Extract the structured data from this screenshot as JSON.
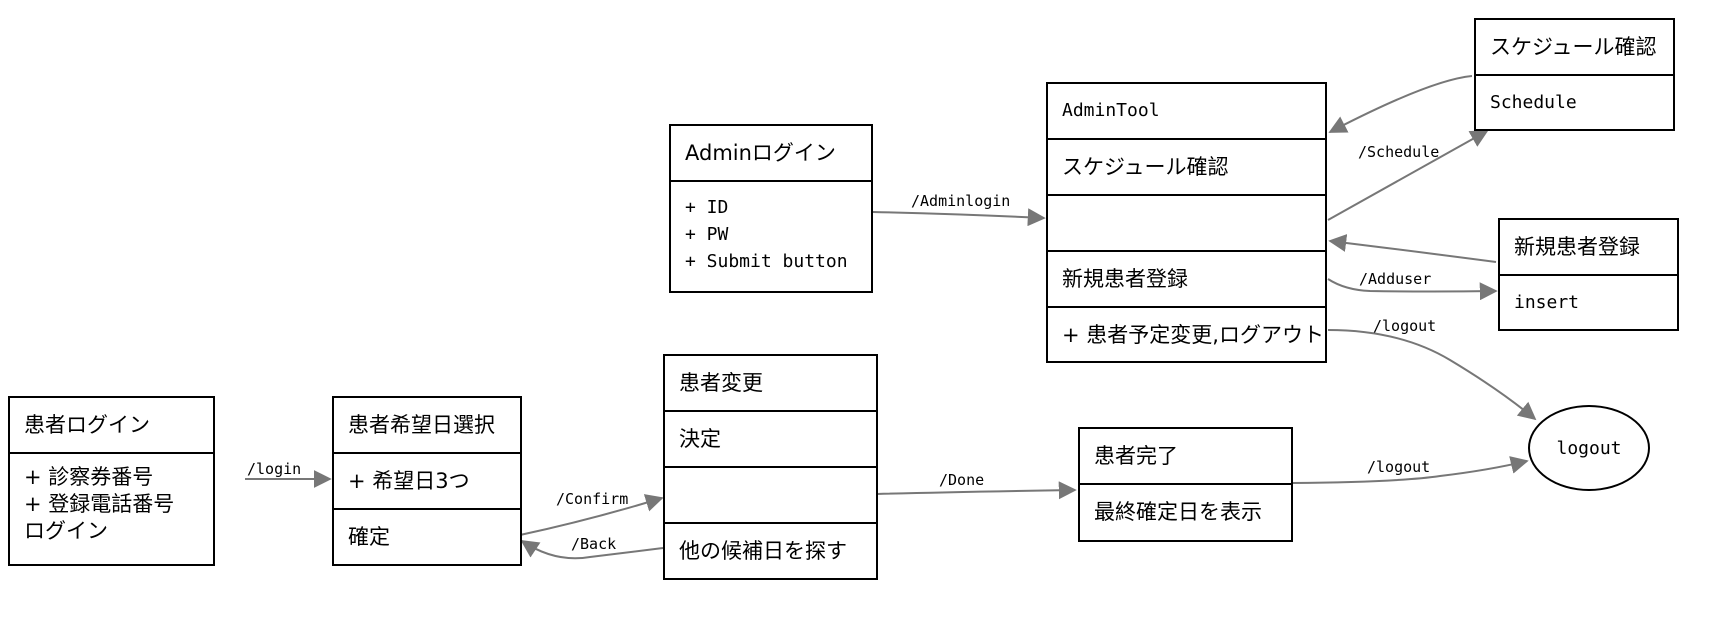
{
  "colors": {
    "edge": "#777777",
    "stroke": "#000000"
  },
  "nodes": {
    "patient_login": {
      "title": "患者ログイン",
      "lines": [
        "+ 診察券番号",
        "+ 登録電話番号",
        "ログイン"
      ]
    },
    "patient_select": {
      "title": "患者希望日選択",
      "field": "+ 希望日3つ",
      "confirm": "確定"
    },
    "patient_change": {
      "title": "患者変更",
      "decide": "決定",
      "empty": "",
      "search": "他の候補日を探す"
    },
    "patient_done": {
      "title": "患者完了",
      "show": "最終確定日を表示"
    },
    "admin_login": {
      "title": "Adminログイン",
      "lines": [
        "+ ID",
        "+ PW",
        "+ Submit button"
      ]
    },
    "admin_tool": {
      "title": "AdminTool",
      "schedule": "スケジュール確認",
      "empty": "",
      "register": "新規患者登録",
      "bottom": "+ 患者予定変更,ログアウト"
    },
    "schedule_check": {
      "title": "スケジュール確認",
      "body": "Schedule"
    },
    "new_patient": {
      "title": "新規患者登録",
      "body": "insert"
    },
    "logout": {
      "label": "logout"
    }
  },
  "edges": {
    "login": "/login",
    "confirm": "/Confirm",
    "back": "/Back",
    "done": "/Done",
    "logout_done": "/logout",
    "adminlogin": "/Adminlogin",
    "schedule": "/Schedule",
    "adduser": "/Adduser",
    "logout_admin": "/logout"
  }
}
